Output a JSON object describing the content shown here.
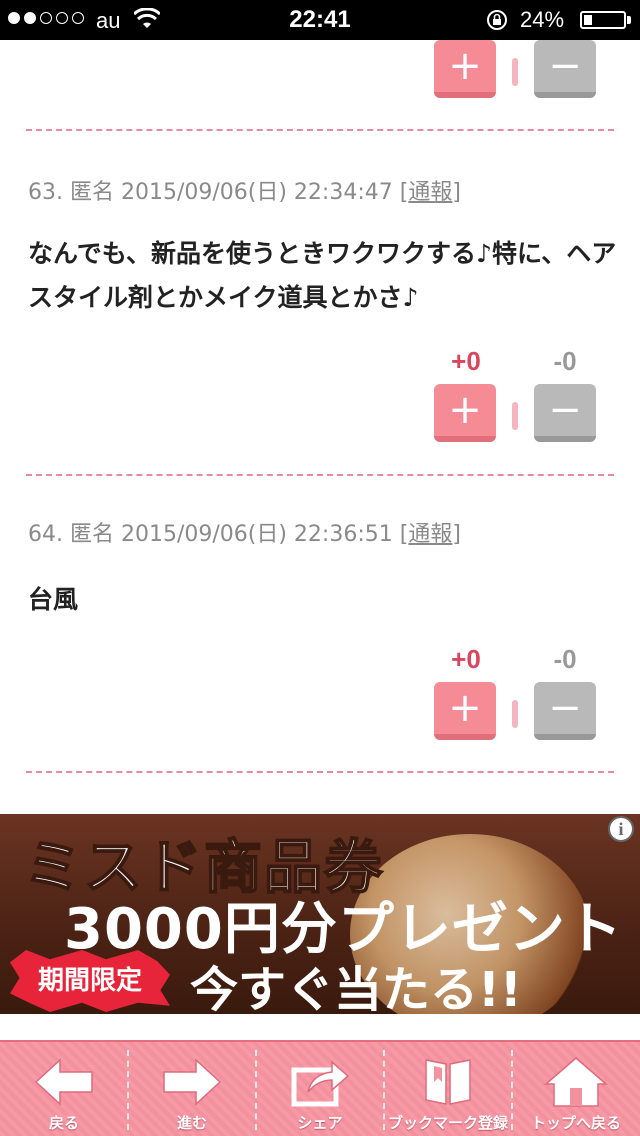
{
  "status_bar": {
    "carrier": "au",
    "time": "22:41",
    "battery_percent": "24%",
    "signal_filled": 2,
    "signal_total": 5
  },
  "votes": [
    {
      "plus_label": "+",
      "minus_label": "−"
    },
    {
      "plus_count": "+0",
      "minus_count": "-0",
      "plus_label": "+",
      "minus_label": "−"
    },
    {
      "plus_count": "+0",
      "minus_count": "-0",
      "plus_label": "+",
      "minus_label": "−"
    }
  ],
  "comments": [
    {
      "meta": "63. 匿名 2015/09/06(日) 22:34:47",
      "report_open": "[",
      "report_label": "通報",
      "report_close": "]",
      "body": "なんでも、新品を使うときワクワクする♪特に、ヘアスタイル剤とかメイク道具とかさ♪"
    },
    {
      "meta": "64. 匿名 2015/09/06(日) 22:36:51",
      "report_open": "[",
      "report_label": "通報",
      "report_close": "]",
      "body": "台風"
    }
  ],
  "ad": {
    "line1": "ミスド商品券",
    "line2": "3000円分プレゼント",
    "badge": "期間限定",
    "line3": "今すぐ当たる!!",
    "info": "i"
  },
  "toolbar": {
    "items": [
      {
        "label": "戻る",
        "icon": "arrow-left-icon"
      },
      {
        "label": "進む",
        "icon": "arrow-right-icon"
      },
      {
        "label": "シェア",
        "icon": "share-icon"
      },
      {
        "label": "ブックマーク登録",
        "icon": "book-icon"
      },
      {
        "label": "トップへ戻る",
        "icon": "home-icon"
      }
    ]
  },
  "colors": {
    "plus_button": "#f48b95",
    "minus_button": "#b9b9b9",
    "plus_count": "#d9465e",
    "divider": "#e58aa0",
    "toolbar": "#f59aa6"
  }
}
